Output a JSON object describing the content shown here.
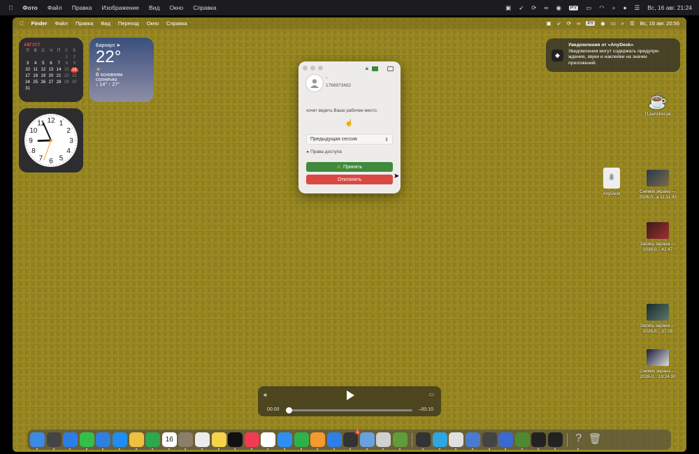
{
  "outer_menubar": {
    "app": "Фото",
    "items": [
      "Файл",
      "Правка",
      "Изображение",
      "Вид",
      "Окно",
      "Справка"
    ],
    "lang": "PY",
    "datetime": "Вс, 16 авг.  21:24"
  },
  "inner_menubar": {
    "app": "Finder",
    "items": [
      "Файл",
      "Правка",
      "Вид",
      "Переход",
      "Окно",
      "Справка"
    ],
    "lang": "PY",
    "datetime": "Вс, 16 авг.  20:56"
  },
  "calendar": {
    "month": "АВГУСТ",
    "headers": [
      "П",
      "В",
      "С",
      "Ч",
      "П",
      "С",
      "В"
    ],
    "weeks": [
      [
        "",
        "",
        "",
        "",
        "",
        "1",
        "2"
      ],
      [
        "3",
        "4",
        "5",
        "6",
        "7",
        "8",
        "9"
      ],
      [
        "10",
        "11",
        "12",
        "13",
        "14",
        "15",
        "16"
      ],
      [
        "17",
        "18",
        "19",
        "20",
        "21",
        "22",
        "23"
      ],
      [
        "24",
        "25",
        "26",
        "27",
        "28",
        "29",
        "30"
      ],
      [
        "31",
        "",
        "",
        "",
        "",
        "",
        ""
      ]
    ],
    "today": "16"
  },
  "weather": {
    "city": "Барнаул",
    "temp": "22°",
    "condition_line1": "В основном",
    "condition_line2": "солнечно",
    "range": "↓ 14° ↑ 27°"
  },
  "clock": {
    "numbers": [
      "12",
      "1",
      "2",
      "3",
      "4",
      "5",
      "6",
      "7",
      "8",
      "9",
      "10",
      "11"
    ],
    "time": "20:56"
  },
  "dialog": {
    "username": "-",
    "user_id": "1768973482",
    "message": "хочет видеть Ваше рабочее место.",
    "session_select": "Предыдущая сессия",
    "access_label": "Права доступа",
    "accept_label": "Принять",
    "decline_label": "Отклонить"
  },
  "notification": {
    "title": "Уведомления от «AnyDesk»",
    "body": "Уведомления могут содержать предупре-ждения, звуки и наклейки на значки приложений."
  },
  "desktop_icons": [
    {
      "label": "TLauncher.jar"
    },
    {
      "label": "AnyDesk"
    },
    {
      "label_line1": "Снимок экрана —",
      "label_line2": "2026-0...а 11.11.43"
    },
    {
      "label_line1": "Запись экрана —",
      "label_line2": "2026-0....42.47"
    },
    {
      "label_line1": "Запись экрана —",
      "label_line2": "2026-0....37.08"
    },
    {
      "label_line1": "Снимок экрана —",
      "label_line2": "2026-0... 19.24.00"
    }
  ],
  "player": {
    "current": "00:00",
    "remaining": "–00:10",
    "progress": 0
  },
  "dock": {
    "badge": "1",
    "calendar_day": "16",
    "apps": [
      {
        "name": "finder",
        "color": "#3d8ae6"
      },
      {
        "name": "launchpad",
        "color": "#444"
      },
      {
        "name": "safari",
        "color": "#2c7ee6"
      },
      {
        "name": "messages",
        "color": "#33c04a"
      },
      {
        "name": "mail",
        "color": "#2f7fe0"
      },
      {
        "name": "appstore",
        "color": "#1f8ef0"
      },
      {
        "name": "photos",
        "color": "#f0c040"
      },
      {
        "name": "facetime",
        "color": "#2fa84a"
      },
      {
        "name": "calendar",
        "color": "#ffffff"
      },
      {
        "name": "contacts",
        "color": "#8d7e6a"
      },
      {
        "name": "reminders",
        "color": "#ececec"
      },
      {
        "name": "notes",
        "color": "#f6d44a"
      },
      {
        "name": "tv",
        "color": "#111"
      },
      {
        "name": "music",
        "color": "#f23a52"
      },
      {
        "name": "freeform",
        "color": "#ffffff"
      },
      {
        "name": "keynote",
        "color": "#2f8ff0"
      },
      {
        "name": "numbers",
        "color": "#2fb14a"
      },
      {
        "name": "pages",
        "color": "#f59a2f"
      },
      {
        "name": "xcode",
        "color": "#2f7fe6"
      },
      {
        "name": "chatgpt",
        "color": "#333"
      },
      {
        "name": "preview",
        "color": "#6aa0e0"
      },
      {
        "name": "roblox",
        "color": "#d0d0d0"
      },
      {
        "name": "minecraft",
        "color": "#5f9d3a"
      },
      {
        "name": "anydesk-small",
        "color": "#333"
      },
      {
        "name": "telegram",
        "color": "#2ea6e0"
      },
      {
        "name": "chrome",
        "color": "#e0e0e0"
      },
      {
        "name": "vpn",
        "color": "#4a7bd0"
      },
      {
        "name": "calculator",
        "color": "#444"
      },
      {
        "name": "bars-app",
        "color": "#3a6ad0"
      },
      {
        "name": "minecraft-2",
        "color": "#4f8a30"
      },
      {
        "name": "anydesk",
        "color": "#222"
      },
      {
        "name": "anydesk-2",
        "color": "#222"
      },
      {
        "name": "help",
        "color": "transparent"
      },
      {
        "name": "trash",
        "color": "transparent"
      }
    ]
  }
}
